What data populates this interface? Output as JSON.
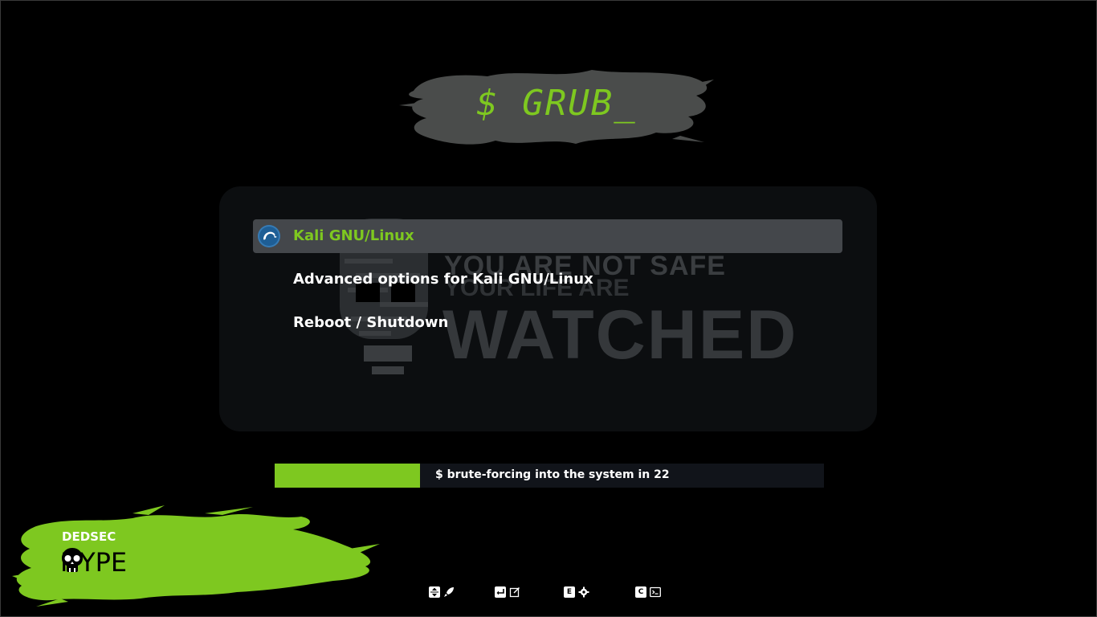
{
  "title": {
    "text": "$ GRUB_"
  },
  "watermark": {
    "line1": "YOU ARE NOT SAFE",
    "line2": "YOUR LIFE ARE",
    "line3": "WATCHED"
  },
  "menu": {
    "entries": [
      {
        "label": "Kali GNU/Linux",
        "selected": true,
        "icon": "kali-dragon-icon"
      },
      {
        "label": "Advanced options for Kali GNU/Linux",
        "selected": false
      },
      {
        "label": "Reboot / Shutdown",
        "selected": false
      }
    ]
  },
  "countdown": {
    "text": "$ brute-forcing into the system in 22",
    "progress_fraction": 0.265
  },
  "badge": {
    "top": "DEDSEC",
    "bottom": "HYPE",
    "icon": "skull-icon"
  },
  "hints": [
    {
      "key_icon": "up-down-arrows-icon",
      "action_icon": "rocket-icon"
    },
    {
      "key_icon": "enter-key-icon",
      "action_icon": "edit-icon"
    },
    {
      "key": "E",
      "action_icon": "gear-icon"
    },
    {
      "key": "C",
      "action_icon": "terminal-icon"
    }
  ],
  "colors": {
    "accent": "#7ec820",
    "background": "#000000",
    "panel": "#0c0e10",
    "selected": "#44474b"
  }
}
